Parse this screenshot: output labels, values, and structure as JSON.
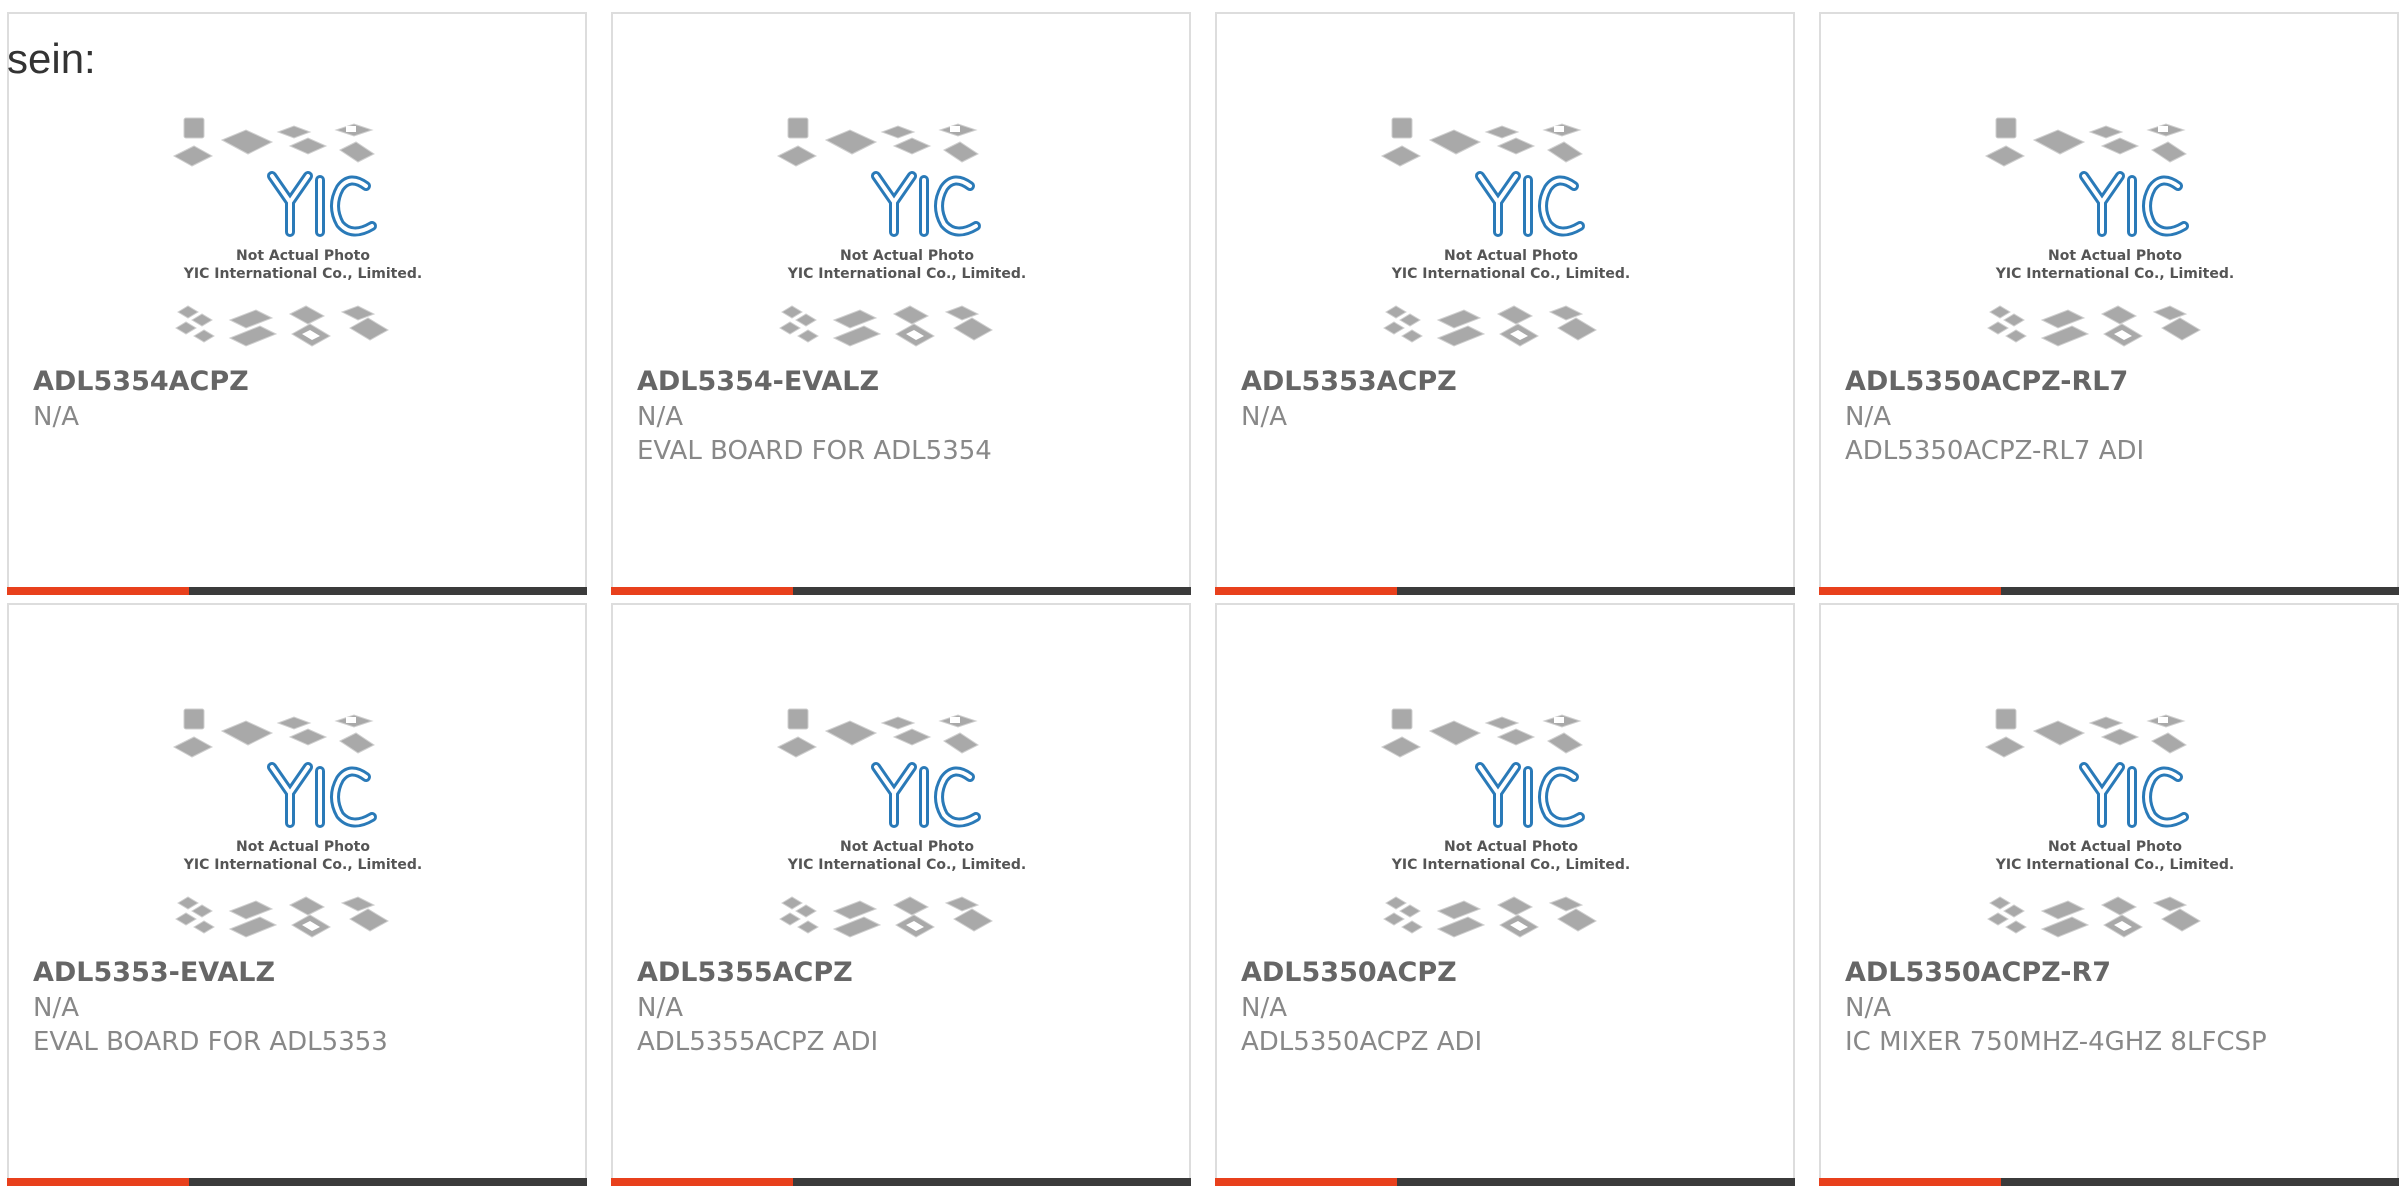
{
  "intro_text": "sein:",
  "colors": {
    "accent": "#e8401c",
    "bar": "#3b3b3b",
    "border": "#dddddd",
    "title": "#666666",
    "text": "#888888",
    "logo_blue": "#2a7ab8"
  },
  "thumbnail": {
    "line1": "Not Actual Photo",
    "line2": "YIC International Co., Limited."
  },
  "products": [
    {
      "name": "ADL5354ACPZ",
      "manufacturer": "N/A",
      "description": ""
    },
    {
      "name": "ADL5354-EVALZ",
      "manufacturer": "N/A",
      "description": "EVAL BOARD FOR ADL5354"
    },
    {
      "name": "ADL5353ACPZ",
      "manufacturer": "N/A",
      "description": ""
    },
    {
      "name": "ADL5350ACPZ-RL7",
      "manufacturer": "N/A",
      "description": "ADL5350ACPZ-RL7 ADI"
    },
    {
      "name": "ADL5353-EVALZ",
      "manufacturer": "N/A",
      "description": "EVAL BOARD FOR ADL5353"
    },
    {
      "name": "ADL5355ACPZ",
      "manufacturer": "N/A",
      "description": "ADL5355ACPZ ADI"
    },
    {
      "name": "ADL5350ACPZ",
      "manufacturer": "N/A",
      "description": "ADL5350ACPZ ADI"
    },
    {
      "name": "ADL5350ACPZ-R7",
      "manufacturer": "N/A",
      "description": "IC MIXER 750MHZ-4GHZ 8LFCSP"
    }
  ]
}
